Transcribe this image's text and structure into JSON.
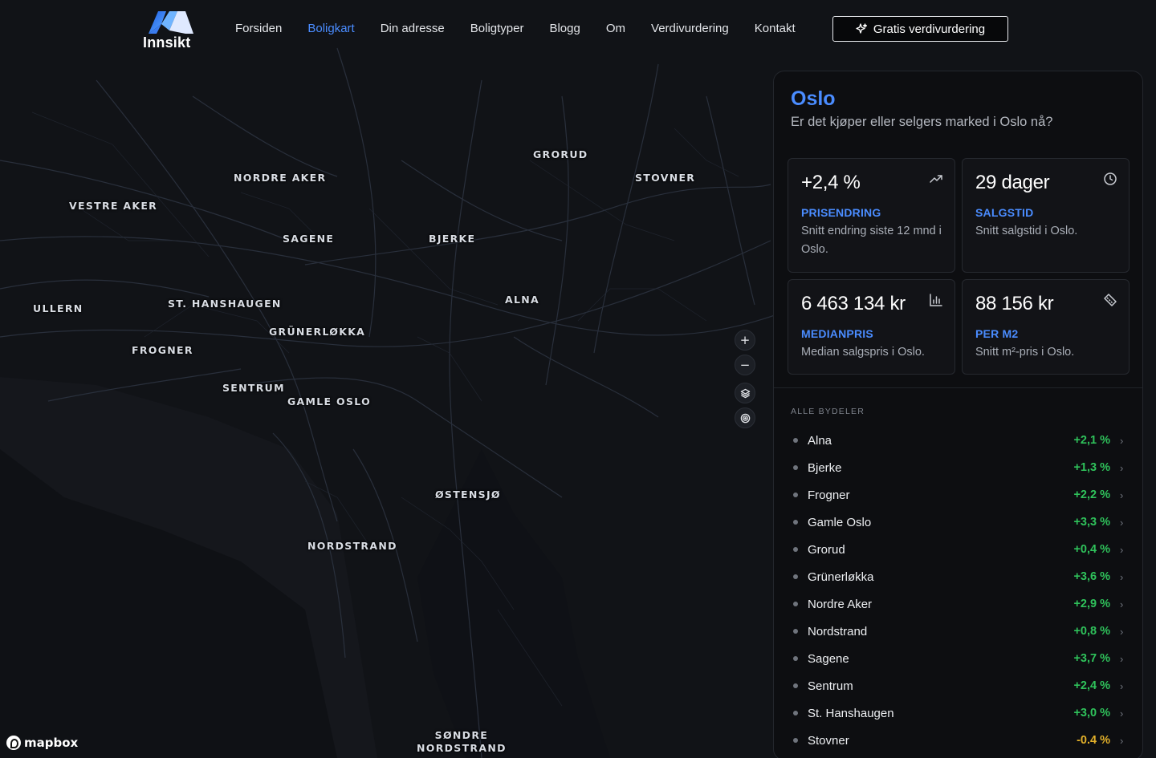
{
  "header": {
    "logo_text": "Innsikt",
    "nav": [
      {
        "label": "Forsiden",
        "active": false
      },
      {
        "label": "Boligkart",
        "active": true
      },
      {
        "label": "Din adresse",
        "active": false
      },
      {
        "label": "Boligtyper",
        "active": false
      },
      {
        "label": "Blogg",
        "active": false
      },
      {
        "label": "Om",
        "active": false
      },
      {
        "label": "Verdivurdering",
        "active": false
      },
      {
        "label": "Kontakt",
        "active": false
      }
    ],
    "cta_label": "Gratis verdivurdering"
  },
  "map": {
    "labels": [
      {
        "text": "GRORUD"
      },
      {
        "text": "NORDRE AKER"
      },
      {
        "text": "STOVNER"
      },
      {
        "text": "VESTRE AKER"
      },
      {
        "text": "SAGENE"
      },
      {
        "text": "BJERKE"
      },
      {
        "text": "ALNA"
      },
      {
        "text": "ULLERN"
      },
      {
        "text": "ST. HANSHAUGEN"
      },
      {
        "text": "GRÜNERLØKKA"
      },
      {
        "text": "FROGNER"
      },
      {
        "text": "SENTRUM"
      },
      {
        "text": "GAMLE OSLO"
      },
      {
        "text": "ØSTENSJØ"
      },
      {
        "text": "NORDSTRAND"
      },
      {
        "text": "SØNDRE\nNORDSTRAND"
      }
    ],
    "attribution": "mapbox",
    "controls": {
      "zoom_in": "+",
      "zoom_out": "−"
    }
  },
  "panel": {
    "title": "Oslo",
    "subtitle": "Er det kjøper eller selgers marked i Oslo nå?",
    "stats": [
      {
        "value": "+2,4 %",
        "label": "PRISENDRING",
        "desc": "Snitt endring siste 12 mnd i Oslo.",
        "icon": "trend-up-icon"
      },
      {
        "value": "29 dager",
        "label": "SALGSTID",
        "desc": "Snitt salgstid i Oslo.",
        "icon": "clock-icon"
      },
      {
        "value": "6 463 134 kr",
        "label": "MEDIANPRIS",
        "desc": "Median salgspris i Oslo.",
        "icon": "bar-chart-icon"
      },
      {
        "value": "88 156 kr",
        "label": "PER M2",
        "desc": "Snitt m²-pris i Oslo.",
        "icon": "ruler-icon"
      }
    ],
    "section_title": "ALLE BYDELER",
    "districts": [
      {
        "name": "Alna",
        "change": "+2,1 %"
      },
      {
        "name": "Bjerke",
        "change": "+1,3 %"
      },
      {
        "name": "Frogner",
        "change": "+2,2 %"
      },
      {
        "name": "Gamle Oslo",
        "change": "+3,3 %"
      },
      {
        "name": "Grorud",
        "change": "+0,4 %"
      },
      {
        "name": "Grünerløkka",
        "change": "+3,6 %"
      },
      {
        "name": "Nordre Aker",
        "change": "+2,9 %"
      },
      {
        "name": "Nordstrand",
        "change": "+0,8 %"
      },
      {
        "name": "Sagene",
        "change": "+3,7 %"
      },
      {
        "name": "Sentrum",
        "change": "+2,4 %"
      },
      {
        "name": "St. Hanshaugen",
        "change": "+3,0 %"
      },
      {
        "name": "Stovner",
        "change": "-0.4 %"
      }
    ]
  },
  "colors": {
    "accent": "#4a8cff",
    "positive": "#2fc25b",
    "negative": "#e2b02a",
    "background": "#0b0c0f"
  }
}
